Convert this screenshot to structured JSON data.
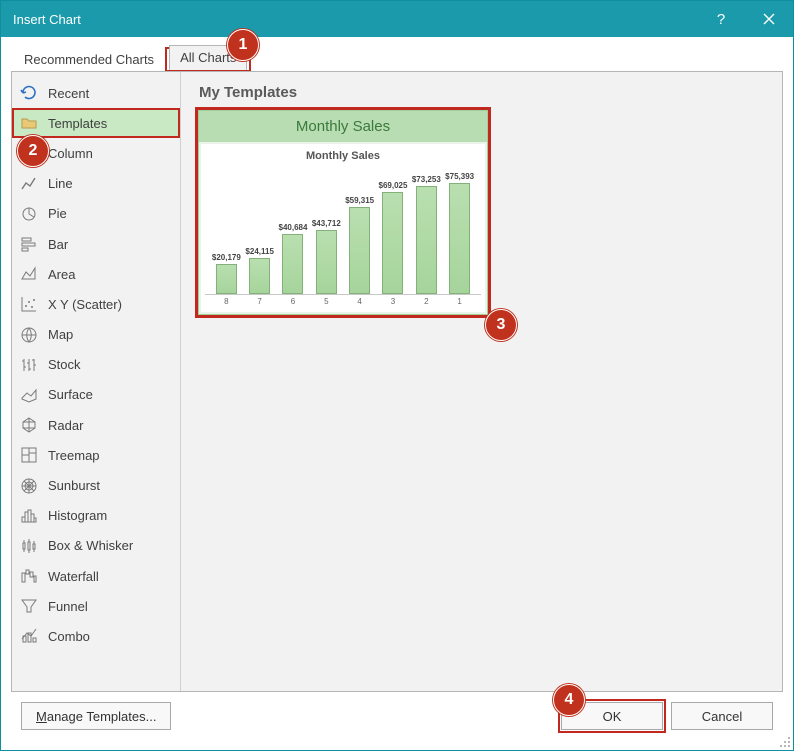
{
  "window": {
    "title": "Insert Chart"
  },
  "tabs": {
    "recommended": "Recommended Charts",
    "all": "All Charts"
  },
  "categories": [
    {
      "key": "recent",
      "label": "Recent"
    },
    {
      "key": "templates",
      "label": "Templates"
    },
    {
      "key": "column",
      "label": "Column"
    },
    {
      "key": "line",
      "label": "Line"
    },
    {
      "key": "pie",
      "label": "Pie"
    },
    {
      "key": "bar",
      "label": "Bar"
    },
    {
      "key": "area",
      "label": "Area"
    },
    {
      "key": "scatter",
      "label": "X Y (Scatter)"
    },
    {
      "key": "map",
      "label": "Map"
    },
    {
      "key": "stock",
      "label": "Stock"
    },
    {
      "key": "surface",
      "label": "Surface"
    },
    {
      "key": "radar",
      "label": "Radar"
    },
    {
      "key": "treemap",
      "label": "Treemap"
    },
    {
      "key": "sunburst",
      "label": "Sunburst"
    },
    {
      "key": "histogram",
      "label": "Histogram"
    },
    {
      "key": "boxwhisker",
      "label": "Box & Whisker"
    },
    {
      "key": "waterfall",
      "label": "Waterfall"
    },
    {
      "key": "funnel",
      "label": "Funnel"
    },
    {
      "key": "combo",
      "label": "Combo"
    }
  ],
  "section_header": "My Templates",
  "template": {
    "title_top": "Monthly Sales",
    "inner_title": "Monthly Sales"
  },
  "buttons": {
    "manage_prefix": "M",
    "manage_rest": "anage Templates...",
    "ok": "OK",
    "cancel": "Cancel"
  },
  "callouts": {
    "c1": "1",
    "c2": "2",
    "c3": "3",
    "c4": "4"
  },
  "chart_data": {
    "type": "bar",
    "title": "Monthly Sales",
    "categories": [
      "8",
      "7",
      "6",
      "5",
      "4",
      "3",
      "2",
      "1"
    ],
    "values": [
      20179,
      24115,
      40684,
      43712,
      59315,
      69025,
      73253,
      75393
    ],
    "value_labels": [
      "$20,179",
      "$24,115",
      "$40,684",
      "$43,712",
      "$59,315",
      "$69,025",
      "$73,253",
      "$75,393"
    ],
    "ylim": [
      0,
      80000
    ],
    "xlabel": "",
    "ylabel": ""
  }
}
